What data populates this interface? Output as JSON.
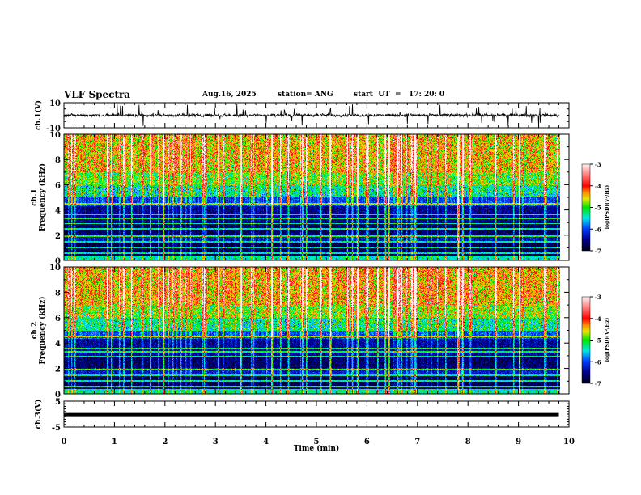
{
  "header": {
    "title": "VLF Spectra",
    "date": "Aug.16, 2025",
    "station": "station= ANG",
    "start": "start  UT  =   17: 20: 0"
  },
  "chart_data": [
    {
      "type": "line",
      "panel": "ch1-waveform",
      "ylabel": "ch.1(V)",
      "ylim": [
        -10,
        10
      ],
      "yticklabels": [
        "10",
        "-10"
      ],
      "xlim": [
        0,
        10
      ],
      "data_extent_min": 9.8,
      "description_of_signal": "noise near 0 V with impulsive spikes"
    },
    {
      "type": "heatmap",
      "panel": "ch1-spectrogram",
      "ylabel": "ch.1\nFrequency (kHz)",
      "ylim": [
        0,
        10
      ],
      "yticklabels": [
        "0",
        "2",
        "4",
        "6",
        "8",
        "10"
      ],
      "xlim": [
        0,
        10
      ],
      "colorbar": {
        "label": "log(PSD)(V²/Hz)",
        "range": [
          -7,
          -3
        ],
        "ticklabels": [
          "-3",
          "-4",
          "-5",
          "-6",
          "-7"
        ]
      }
    },
    {
      "type": "heatmap",
      "panel": "ch2-spectrogram",
      "ylabel": "ch.2\nFrequency (kHz)",
      "ylim": [
        0,
        10
      ],
      "yticklabels": [
        "0",
        "2",
        "4",
        "6",
        "8",
        "10"
      ],
      "xlim": [
        0,
        10
      ],
      "colorbar": {
        "label": "log(PSD)(V²/Hz)",
        "range": [
          -7,
          -3
        ],
        "ticklabels": [
          "-3",
          "-4",
          "-5",
          "-6",
          "-7"
        ]
      }
    },
    {
      "type": "line",
      "panel": "ch3-waveform",
      "ylabel": "ch.3(V)",
      "ylim": [
        -5,
        5
      ],
      "yticklabels": [
        "5",
        "-5"
      ],
      "xlim": [
        0,
        10
      ],
      "values_constant": -0.2
    }
  ],
  "xaxis": {
    "label": "Time (min)",
    "ticklabels": [
      "0",
      "1",
      "2",
      "3",
      "4",
      "5",
      "6",
      "7",
      "8",
      "9",
      "10"
    ]
  },
  "colormap": [
    "#00001e",
    "#00008c",
    "#003cff",
    "#00e6e6",
    "#00e600",
    "#e6e600",
    "#ff8c00",
    "#ff0000",
    "#ff7878",
    "#fff0f0"
  ]
}
